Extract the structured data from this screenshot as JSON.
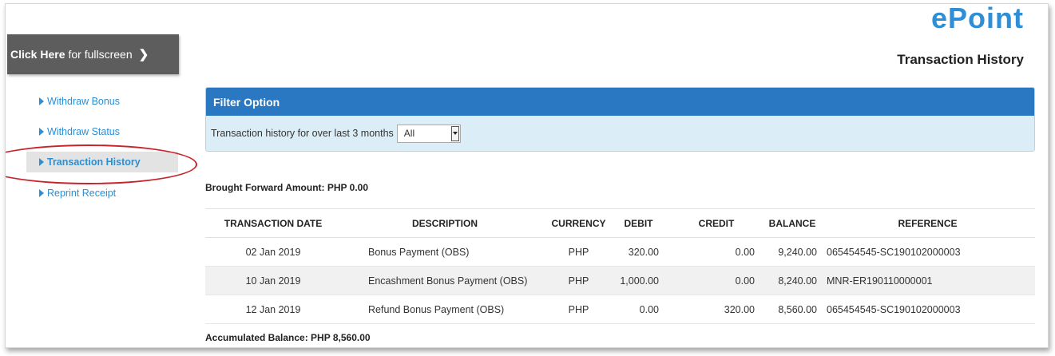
{
  "sidebar": {
    "fullscreen_bold": "Click Here",
    "fullscreen_rest": "for fullscreen",
    "fullscreen_chevron": "❯",
    "items": [
      {
        "label": "Withdraw Bonus"
      },
      {
        "label": "Withdraw Status"
      },
      {
        "label": "Transaction History"
      },
      {
        "label": "Reprint Receipt"
      }
    ]
  },
  "header": {
    "brand": "ePoint",
    "title": "Transaction History"
  },
  "filter": {
    "title": "Filter Option",
    "label": "Transaction history for over last 3 months",
    "selected": "All"
  },
  "summary": {
    "brought_forward": "Brought Forward Amount: PHP 0.00",
    "accumulated": "Accumulated Balance: PHP 8,560.00"
  },
  "table": {
    "headers": [
      "TRANSACTION DATE",
      "DESCRIPTION",
      "CURRENCY",
      "DEBIT",
      "CREDIT",
      "BALANCE",
      "REFERENCE"
    ],
    "rows": [
      [
        "02 Jan 2019",
        "Bonus Payment (OBS)",
        "PHP",
        "320.00",
        "0.00",
        "9,240.00",
        "065454545-SC190102000003"
      ],
      [
        "10 Jan 2019",
        "Encashment Bonus Payment (OBS)",
        "PHP",
        "1,000.00",
        "0.00",
        "8,240.00",
        "MNR-ER190110000001"
      ],
      [
        "12 Jan 2019",
        "Refund Bonus Payment (OBS)",
        "PHP",
        "0.00",
        "320.00",
        "8,560.00",
        "065454545-SC190102000003"
      ]
    ]
  },
  "colors": {
    "accent": "#2b78c2",
    "link": "#2a8fd4",
    "highlight": "#c8232c"
  }
}
